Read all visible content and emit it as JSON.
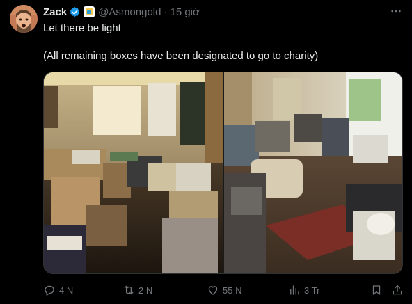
{
  "author": {
    "name": "Zack",
    "handle": "@Asmongold",
    "time": "15 giờ"
  },
  "post": {
    "line1": "Let there be light",
    "line2": "(All remaining boxes have been designated to go to charity)"
  },
  "media": {
    "left_photo": "living-room-cluttered-photo",
    "right_photo": "living-room-partially-cleared-photo"
  },
  "actions": {
    "replies": "4 N",
    "reposts": "2 N",
    "likes": "55 N",
    "views": "3 Tr"
  },
  "colors": {
    "background": "#000000",
    "text": "#e7e9ea",
    "muted": "#71767b",
    "verified": "#1d9bf0"
  }
}
